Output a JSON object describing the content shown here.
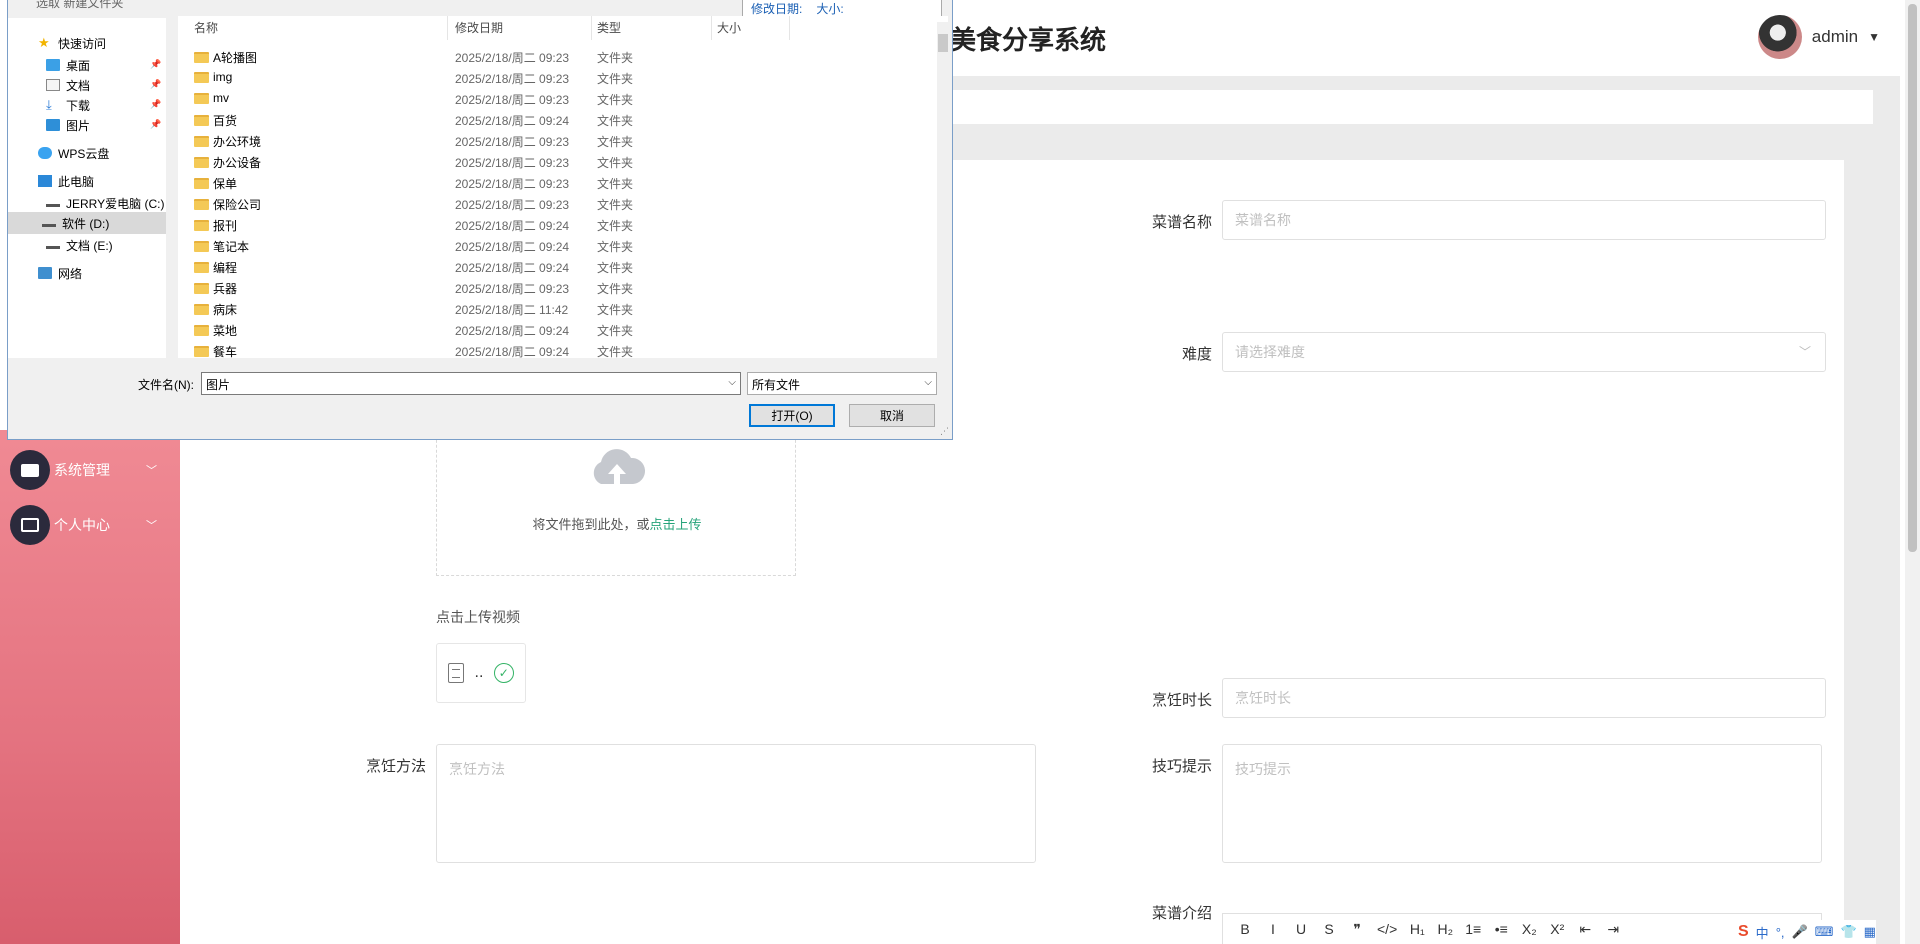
{
  "app": {
    "brand": "美食分享系统",
    "user": "admin"
  },
  "sidebar": {
    "items": [
      {
        "label": "系统管理"
      },
      {
        "label": "个人中心"
      }
    ]
  },
  "form": {
    "recipe_name_label": "菜谱名称",
    "recipe_name_placeholder": "菜谱名称",
    "difficulty_label": "难度",
    "difficulty_placeholder": "请选择难度",
    "upload_text": "将文件拖到此处，或",
    "upload_link": "点击上传",
    "video_label": "点击上传视频",
    "video_file_name": "..",
    "cook_time_label": "烹饪时长",
    "cook_time_placeholder": "烹饪时长",
    "method_label": "烹饪方法",
    "method_placeholder": "烹饪方法",
    "tips_label": "技巧提示",
    "tips_placeholder": "技巧提示",
    "intro_label": "菜谱介绍"
  },
  "editor_toolbar": [
    "B",
    "I",
    "U",
    "S",
    "❞",
    "</>",
    "H₁",
    "H₂",
    "1≡",
    "•≡",
    "X₂",
    "X²",
    "⇤",
    "⇥"
  ],
  "ime": [
    "S",
    "中",
    "°,",
    "🎤",
    "⌨",
    "👕",
    "▦"
  ],
  "dialog": {
    "top_cut": "选取 新建文件夹",
    "preview_date_label": "修改日期:",
    "preview_size_label": "大小:",
    "columns": {
      "name": "名称",
      "date": "修改日期",
      "type": "类型",
      "size": "大小"
    },
    "nav": [
      {
        "label": "快速访问",
        "icon": "star-icon",
        "pinned": false
      },
      {
        "label": "桌面",
        "icon": "desktop-icon",
        "pinned": true
      },
      {
        "label": "文档",
        "icon": "document-icon",
        "pinned": true
      },
      {
        "label": "下载",
        "icon": "download-icon",
        "pinned": true
      },
      {
        "label": "图片",
        "icon": "pictures-icon",
        "pinned": true
      },
      {
        "label": "WPS云盘",
        "icon": "cloud-icon",
        "pinned": false
      },
      {
        "label": "此电脑",
        "icon": "computer-icon",
        "pinned": false
      },
      {
        "label": "JERRY爱电脑 (C:)",
        "icon": "drive-icon",
        "pinned": false
      },
      {
        "label": "软件 (D:)",
        "icon": "drive-icon",
        "pinned": false
      },
      {
        "label": "文档 (E:)",
        "icon": "drive-icon",
        "pinned": false
      },
      {
        "label": "网络",
        "icon": "network-icon",
        "pinned": false
      }
    ],
    "files": [
      {
        "name": "A轮播图",
        "date": "2025/2/18/周二 09:23",
        "type": "文件夹"
      },
      {
        "name": "img",
        "date": "2025/2/18/周二 09:23",
        "type": "文件夹"
      },
      {
        "name": "mv",
        "date": "2025/2/18/周二 09:23",
        "type": "文件夹"
      },
      {
        "name": "百货",
        "date": "2025/2/18/周二 09:24",
        "type": "文件夹"
      },
      {
        "name": "办公环境",
        "date": "2025/2/18/周二 09:23",
        "type": "文件夹"
      },
      {
        "name": "办公设备",
        "date": "2025/2/18/周二 09:23",
        "type": "文件夹"
      },
      {
        "name": "保单",
        "date": "2025/2/18/周二 09:23",
        "type": "文件夹"
      },
      {
        "name": "保险公司",
        "date": "2025/2/18/周二 09:23",
        "type": "文件夹"
      },
      {
        "name": "报刊",
        "date": "2025/2/18/周二 09:24",
        "type": "文件夹"
      },
      {
        "name": "笔记本",
        "date": "2025/2/18/周二 09:24",
        "type": "文件夹"
      },
      {
        "name": "编程",
        "date": "2025/2/18/周二 09:24",
        "type": "文件夹"
      },
      {
        "name": "兵器",
        "date": "2025/2/18/周二 09:23",
        "type": "文件夹"
      },
      {
        "name": "病床",
        "date": "2025/2/18/周二 11:42",
        "type": "文件夹"
      },
      {
        "name": "菜地",
        "date": "2025/2/18/周二 09:24",
        "type": "文件夹"
      },
      {
        "name": "餐车",
        "date": "2025/2/18/周二 09:24",
        "type": "文件夹"
      }
    ],
    "filename_label": "文件名(N):",
    "filename_value": "图片",
    "filetype_value": "所有文件",
    "open_button": "打开(O)",
    "cancel_button": "取消"
  }
}
